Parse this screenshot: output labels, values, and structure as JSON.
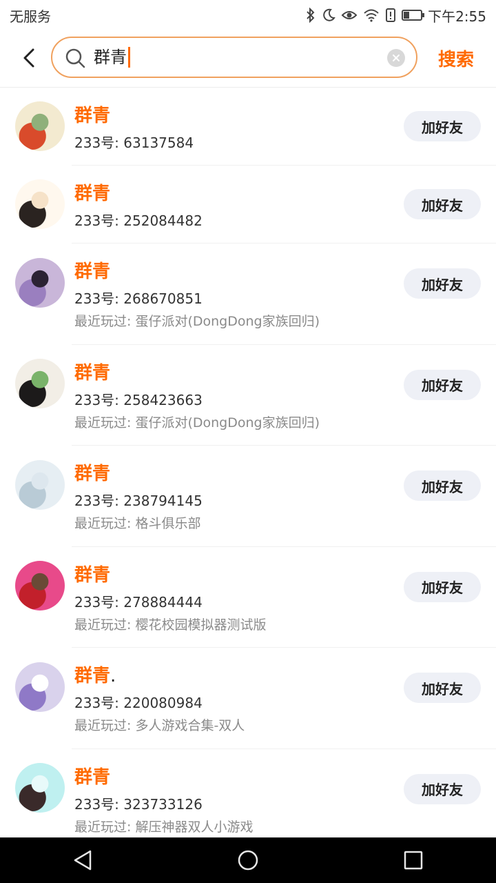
{
  "status_bar": {
    "carrier": "无服务",
    "time": "下午2:55"
  },
  "search": {
    "query": "群青",
    "button_label": "搜索"
  },
  "results": [
    {
      "name": "群青",
      "suffix": "",
      "uid": "233号: 63137584",
      "recent": "",
      "button": "加好友",
      "avatar_colors": [
        "#f3ead0",
        "#d94b2b",
        "#8fb07a"
      ]
    },
    {
      "name": "群青",
      "suffix": "",
      "uid": "233号: 252084482",
      "recent": "",
      "button": "加好友",
      "avatar_colors": [
        "#fff8ee",
        "#2a2320",
        "#f6e2c8"
      ]
    },
    {
      "name": "群青",
      "suffix": "",
      "uid": "233号: 268670851",
      "recent": "最近玩过: 蛋仔派对(DongDong家族回归)",
      "button": "加好友",
      "avatar_colors": [
        "#c9b6d9",
        "#9a7fbf",
        "#2b2233"
      ]
    },
    {
      "name": "群青",
      "suffix": "",
      "uid": "233号: 258423663",
      "recent": "最近玩过: 蛋仔派对(DongDong家族回归)",
      "button": "加好友",
      "avatar_colors": [
        "#f2eee6",
        "#1c1a1a",
        "#7ab36a"
      ]
    },
    {
      "name": "群青",
      "suffix": "",
      "uid": "233号: 238794145",
      "recent": "最近玩过: 格斗俱乐部",
      "button": "加好友",
      "avatar_colors": [
        "#e6eef3",
        "#b9cbd6",
        "#dde7ee"
      ]
    },
    {
      "name": "群青",
      "suffix": "",
      "uid": "233号: 278884444",
      "recent": "最近玩过: 樱花校园模拟器测试版",
      "button": "加好友",
      "avatar_colors": [
        "#e84a8a",
        "#c2202b",
        "#6a4a36"
      ]
    },
    {
      "name": "群青",
      "suffix": ".",
      "uid": "233号: 220080984",
      "recent": "最近玩过: 多人游戏合集-双人",
      "button": "加好友",
      "avatar_colors": [
        "#d9d2ec",
        "#8f79c7",
        "#ffffff"
      ]
    },
    {
      "name": "群青",
      "suffix": "",
      "uid": "233号: 323733126",
      "recent": "最近玩过: 解压神器双人小游戏",
      "button": "加好友",
      "avatar_colors": [
        "#bff0f0",
        "#3a2a2a",
        "#e8fafa"
      ]
    }
  ],
  "colors": {
    "accent": "#ff6a00",
    "search_border": "#f0a15e",
    "button_bg": "#eef0f6"
  }
}
